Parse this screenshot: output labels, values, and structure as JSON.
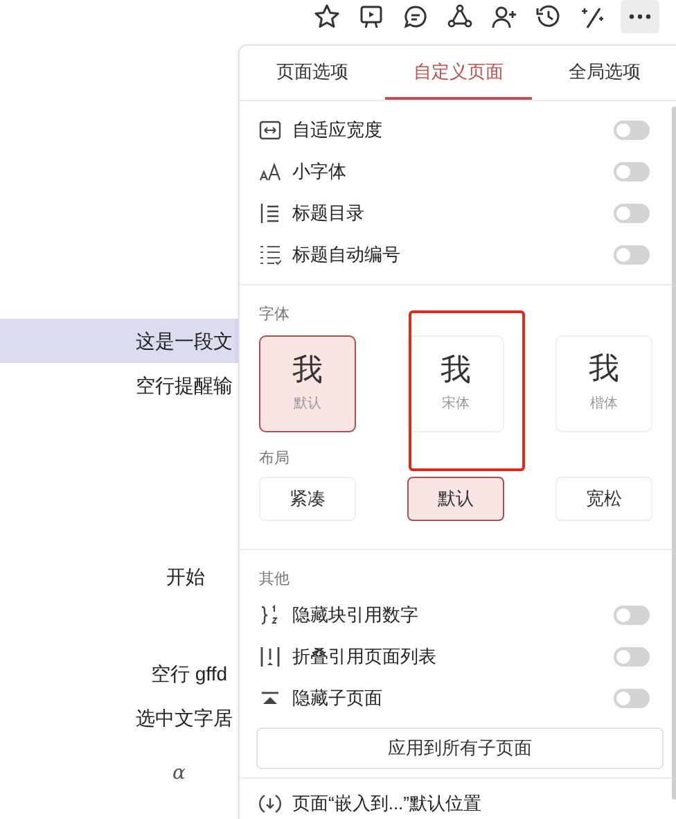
{
  "page": {
    "symbol": "α",
    "lines": [
      {
        "text": "这是一段文",
        "selected": true
      },
      {
        "text": "空行提醒输",
        "selected": false
      },
      {
        "text": "开始",
        "selected": false
      },
      {
        "text": "空行 gffd",
        "selected": false
      },
      {
        "text": "选中文字居",
        "selected": false
      }
    ]
  },
  "panel": {
    "tabs": [
      {
        "label": "页面选项",
        "selected": false
      },
      {
        "label": "自定义页面",
        "selected": true
      },
      {
        "label": "全局选项",
        "selected": false
      }
    ],
    "toggles": [
      {
        "label": "自适应宽度",
        "on": false
      },
      {
        "label": "小字体",
        "on": false
      },
      {
        "label": "标题目录",
        "on": false
      },
      {
        "label": "标题自动编号",
        "on": false
      }
    ],
    "font_section": {
      "title": "字体",
      "options": [
        {
          "glyph": "我",
          "label": "默认",
          "selected": true
        },
        {
          "glyph": "我",
          "label": "宋体",
          "selected": false
        },
        {
          "glyph": "我",
          "label": "楷体",
          "selected": false
        }
      ]
    },
    "layout_section": {
      "title": "布局",
      "options": [
        {
          "label": "紧凑",
          "selected": false
        },
        {
          "label": "默认",
          "selected": true
        },
        {
          "label": "宽松",
          "selected": false
        }
      ]
    },
    "other_section": {
      "title": "其他",
      "toggles": [
        {
          "label": "隐藏块引用数字",
          "on": false
        },
        {
          "label": "折叠引用页面列表",
          "on": false
        },
        {
          "label": "隐藏子页面",
          "on": false
        }
      ]
    },
    "apply_button": "应用到所有子页面",
    "last_row": "页面“嵌入到...”默认位置"
  }
}
